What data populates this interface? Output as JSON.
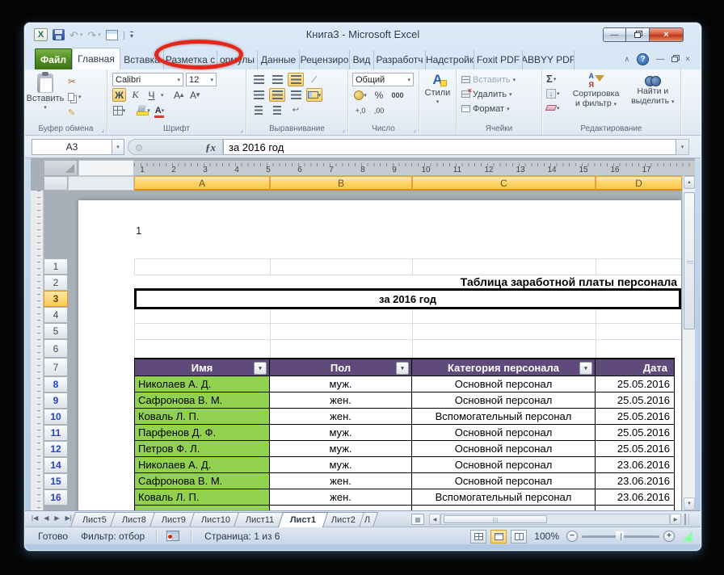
{
  "window": {
    "title": "Книга3  -  Microsoft Excel"
  },
  "icons": {
    "logo": "X",
    "dropdown": "▾",
    "undo": "↶",
    "redo": "↷",
    "pipe": "|",
    "min": "—",
    "close": "×",
    "collapse": "∧",
    "help": "?",
    "cut": "✂",
    "painter": "✎",
    "fx": "ƒx",
    "dot": "",
    "up": "▲",
    "down": "▼",
    "left": "◀",
    "right": "▶",
    "first": "|◀",
    "last": "▶|",
    "chev": "▾",
    "wrap": "↩",
    "orient": "∕",
    "sigma": "Σ",
    "filldown": "↓",
    "percent": "%",
    "thousands": "000",
    "dec_inc": "+,0",
    "dec_dec": ",00",
    "insert_sheet": "▦"
  },
  "ribbon": {
    "tabs": [
      {
        "id": "file",
        "label": "Файл",
        "type": "file"
      },
      {
        "id": "home",
        "label": "Главная",
        "type": "active"
      },
      {
        "id": "insert",
        "label": "Вставка"
      },
      {
        "id": "page-layout",
        "label": "Разметка с",
        "type": "highlighted"
      },
      {
        "id": "formulas",
        "label": "ормулы"
      },
      {
        "id": "data",
        "label": "Данные"
      },
      {
        "id": "review",
        "label": "Рецензиро"
      },
      {
        "id": "view",
        "label": "Вид"
      },
      {
        "id": "developer",
        "label": "Разработч"
      },
      {
        "id": "addins",
        "label": "Надстройк"
      },
      {
        "id": "foxit",
        "label": "Foxit PDF"
      },
      {
        "id": "abbyy",
        "label": "ABBYY PDF"
      }
    ],
    "groups": {
      "clipboard": {
        "label": "Буфер обмена",
        "paste": "Вставить"
      },
      "font": {
        "label": "Шрифт",
        "family": "Calibri",
        "size": "12",
        "bold": "Ж",
        "italic": "К",
        "underline": "Ч",
        "grow": "А",
        "shrink": "А"
      },
      "alignment": {
        "label": "Выравнивание"
      },
      "number": {
        "label": "Число",
        "format": "Общий"
      },
      "styles": {
        "label": "Стили",
        "icon_letter": "А"
      },
      "cells": {
        "label": "Ячейки",
        "insert": "Вставить",
        "delete": "Удалить",
        "format": "Формат"
      },
      "editing": {
        "label": "Редактирование",
        "sort_line1": "Сортировка",
        "sort_line2": "и фильтр",
        "find_line1": "Найти и",
        "find_line2": "выделить"
      }
    }
  },
  "formula_bar": {
    "name_box": "A3",
    "value": "за 2016 год"
  },
  "sheet": {
    "ruler_numbers": [
      "1",
      "2",
      "3",
      "4",
      "5",
      "6",
      "7",
      "8",
      "9",
      "10",
      "11",
      "12",
      "13",
      "14",
      "15",
      "16",
      "17"
    ],
    "columns": [
      "A",
      "B",
      "C",
      "D"
    ],
    "row_headers": [
      "1",
      "2",
      "3",
      "4",
      "5",
      "6",
      "7",
      "8",
      "9",
      "10",
      "11",
      "12",
      "14",
      "15",
      "16"
    ],
    "selected_row": "3",
    "margin_text": "1",
    "title_row2": "Таблица заработной платы персонала",
    "title_row3": "за 2016 год"
  },
  "table": {
    "headers": [
      "Имя",
      "Пол",
      "Категория персонала",
      "Дата"
    ],
    "filter_columns": [
      0,
      1,
      2
    ],
    "rows": [
      [
        "Николаев А. Д.",
        "муж.",
        "Основной персонал",
        "25.05.2016"
      ],
      [
        "Сафронова В. М.",
        "жен.",
        "Основной персонал",
        "25.05.2016"
      ],
      [
        "Коваль Л. П.",
        "жен.",
        "Вспомогательный персонал",
        "25.05.2016"
      ],
      [
        "Парфенов Д. Ф.",
        "муж.",
        "Основной персонал",
        "25.05.2016"
      ],
      [
        "Петров Ф. Л.",
        "муж.",
        "Основной персонал",
        "25.05.2016"
      ],
      [
        "Николаев А. Д.",
        "муж.",
        "Основной персонал",
        "23.06.2016"
      ],
      [
        "Сафронова В. М.",
        "жен.",
        "Основной персонал",
        "23.06.2016"
      ],
      [
        "Коваль Л. П.",
        "жен.",
        "Вспомогательный персонал",
        "23.06.2016"
      ]
    ]
  },
  "sheet_tabs": {
    "tabs": [
      {
        "label": "Лист5"
      },
      {
        "label": "Лист8"
      },
      {
        "label": "Лист9"
      },
      {
        "label": "Лист10"
      },
      {
        "label": "Лист11"
      },
      {
        "label": "Лист1",
        "active": true
      },
      {
        "label": "Лист2"
      },
      {
        "label": "Л",
        "clipped": true
      }
    ]
  },
  "status_bar": {
    "ready": "Готово",
    "filter": "Фильтр: отбор",
    "page": "Страница: 1 из 6",
    "zoom": "100%"
  },
  "colors": {
    "annotation_red": "#e2261a",
    "table_header_purple": "#604a7b",
    "name_cell_green": "#92d050",
    "selection_gold": "#fcca52",
    "file_tab_green": "#569427"
  }
}
